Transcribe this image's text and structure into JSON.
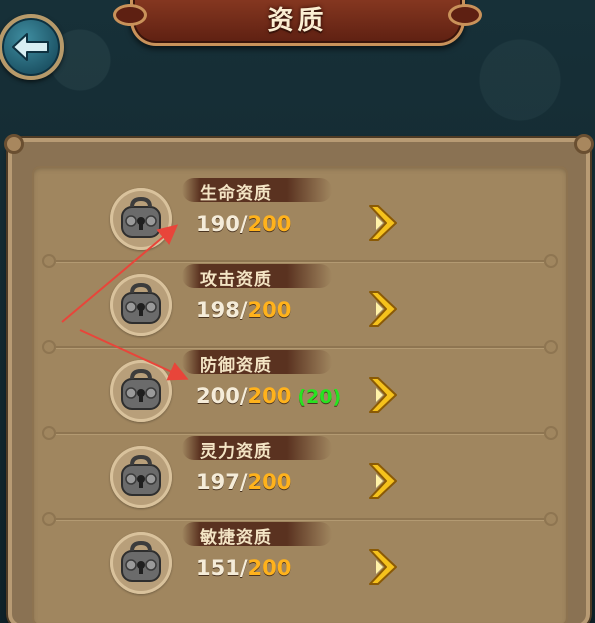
{
  "header": {
    "title": "资质"
  },
  "attributes": [
    {
      "label": "生命资质",
      "current": "190",
      "separator": "/",
      "max": "200",
      "bonus": ""
    },
    {
      "label": "攻击资质",
      "current": "198",
      "separator": "/",
      "max": "200",
      "bonus": ""
    },
    {
      "label": "防御资质",
      "current": "200",
      "separator": "/",
      "max": "200",
      "bonus": "(20)"
    },
    {
      "label": "灵力资质",
      "current": "197",
      "separator": "/",
      "max": "200",
      "bonus": ""
    },
    {
      "label": "敏捷资质",
      "current": "151",
      "separator": "/",
      "max": "200",
      "bonus": ""
    }
  ],
  "icons": {
    "back": "back-arrow-icon",
    "lock": "lock-icon",
    "upgrade": "double-chevron-right-icon"
  },
  "colors": {
    "max_value": "#ffb21c",
    "bonus_value": "#27e320",
    "current_value": "#f5ecd9",
    "annotation_arrow": "#e8453a"
  }
}
